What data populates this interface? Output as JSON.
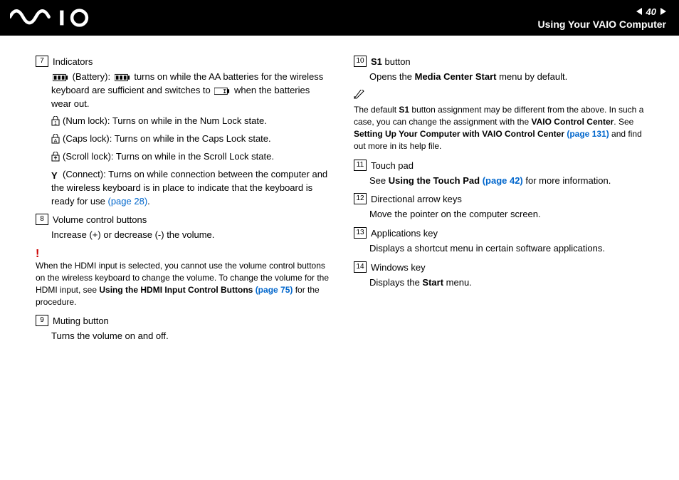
{
  "header": {
    "page_number": "40",
    "section_title": "Using Your VAIO Computer"
  },
  "left": {
    "i7_label": "7",
    "indicators_title": "Indicators",
    "battery_pre": "(Battery): ",
    "battery_mid": " turns on while the AA batteries for the wireless keyboard are sufficient and switches to ",
    "battery_post": " when the batteries wear out.",
    "numlock": "(Num lock): Turns on while in the Num Lock state.",
    "capslock": "(Caps lock): Turns on while in the Caps Lock state.",
    "scrolllock": "(Scroll lock): Turns on while in the Scroll Lock state.",
    "connect_pre": "(Connect): Turns on while connection between the computer and the wireless keyboard is in place to indicate that the keyboard is ready for use ",
    "connect_link": "(page 28)",
    "connect_post": ".",
    "i8_label": "8",
    "volume_title": "Volume control buttons",
    "volume_body": "Increase (+) or decrease (-) the volume.",
    "hdmi_note_a": "When the HDMI input is selected, you cannot use the volume control buttons on the wireless keyboard to change the volume. To change the volume for the HDMI input, see ",
    "hdmi_note_b": "Using the HDMI Input Control Buttons ",
    "hdmi_note_link": "(page 75)",
    "hdmi_note_c": " for the procedure.",
    "i9_label": "9",
    "muting_title": "Muting button",
    "muting_body": "Turns the volume on and off."
  },
  "right": {
    "i10_label": "10",
    "s1_title_a": "S1",
    "s1_title_b": " button",
    "s1_body_a": "Opens the ",
    "s1_body_b": "Media Center Start",
    "s1_body_c": " menu by default.",
    "s1_note_a": "The default ",
    "s1_note_b": "S1",
    "s1_note_c": " button assignment may be different from the above. In such a case, you can change the assignment with the ",
    "s1_note_d": "VAIO Control Center",
    "s1_note_e": ". See ",
    "s1_note_f": "Setting Up Your Computer with VAIO Control Center ",
    "s1_note_link": "(page 131)",
    "s1_note_g": " and find out more in its help file.",
    "i11_label": "11",
    "touchpad_title": "Touch pad",
    "touchpad_body_a": "See ",
    "touchpad_body_b": "Using the Touch Pad ",
    "touchpad_link": "(page 42)",
    "touchpad_body_c": " for more information.",
    "i12_label": "12",
    "arrow_title": "Directional arrow keys",
    "arrow_body": "Move the pointer on the computer screen.",
    "i13_label": "13",
    "apps_title": "Applications key",
    "apps_body": "Displays a shortcut menu in certain software applications.",
    "i14_label": "14",
    "win_title": "Windows key",
    "win_body_a": "Displays the ",
    "win_body_b": "Start",
    "win_body_c": " menu."
  }
}
